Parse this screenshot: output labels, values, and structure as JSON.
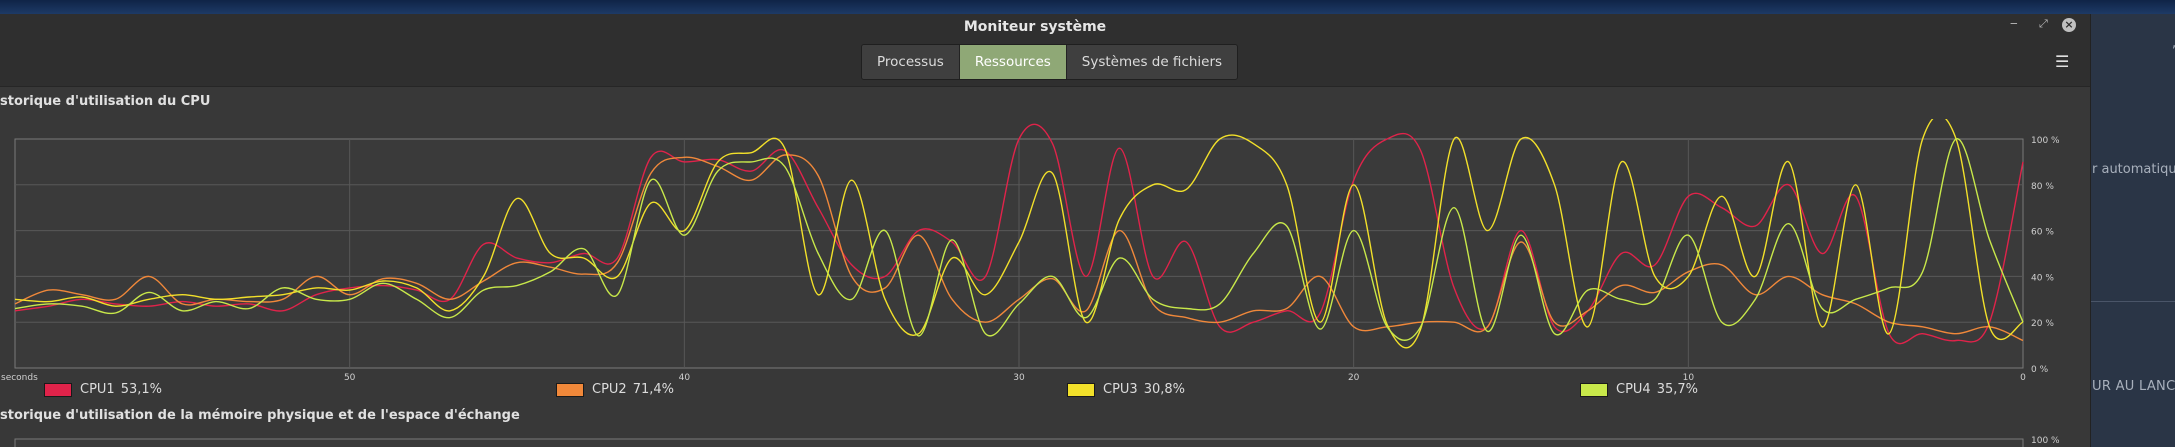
{
  "window": {
    "title": "Moniteur système",
    "tabs": [
      {
        "label": "Processus",
        "active": false
      },
      {
        "label": "Ressources",
        "active": true
      },
      {
        "label": "Systèmes de fichiers",
        "active": false
      }
    ]
  },
  "cpu_section": {
    "title": "storique d'utilisation du CPU",
    "x_ticks": [
      {
        "label": "seconds",
        "value": 60
      },
      {
        "label": "50",
        "value": 50
      },
      {
        "label": "40",
        "value": 40
      },
      {
        "label": "30",
        "value": 30
      },
      {
        "label": "20",
        "value": 20
      },
      {
        "label": "10",
        "value": 10
      },
      {
        "label": "0",
        "value": 0
      }
    ],
    "y_ticks": [
      "0 %",
      "20 %",
      "40 %",
      "60 %",
      "80 %",
      "100 %"
    ]
  },
  "legend": [
    {
      "name": "CPU1",
      "value": "53,1%",
      "color": "#e0234a"
    },
    {
      "name": "CPU2",
      "value": "71,4%",
      "color": "#f0883a"
    },
    {
      "name": "CPU3",
      "value": "30,8%",
      "color": "#f2e02a"
    },
    {
      "name": "CPU4",
      "value": "35,7%",
      "color": "#c8e84a"
    }
  ],
  "mem_section": {
    "title": "storique d'utilisation de la mémoire physique et de l'espace d'échange",
    "y_top_label": "100 %"
  },
  "side_panel": {
    "text1": "r automatiques",
    "text2": "UR AU LANCE"
  },
  "chart_data": {
    "type": "line",
    "title": "storique d'utilisation du CPU",
    "xlabel": "seconds",
    "ylabel": "",
    "xlim": [
      60,
      0
    ],
    "ylim": [
      0,
      100
    ],
    "grid": true,
    "legend_position": "bottom",
    "x": [
      60,
      59,
      58,
      57,
      56,
      55,
      54,
      53,
      52,
      51,
      50,
      49,
      48,
      47,
      46,
      45,
      44,
      43,
      42,
      41,
      40,
      39,
      38,
      37,
      36,
      35,
      34,
      33,
      32,
      31,
      30,
      29,
      28,
      27,
      26,
      25,
      24,
      23,
      22,
      21,
      20,
      19,
      18,
      17,
      16,
      15,
      14,
      13,
      12,
      11,
      10,
      9,
      8,
      7,
      6,
      5,
      4,
      3,
      2,
      1,
      0
    ],
    "series": [
      {
        "name": "CPU1",
        "color": "#e0234a",
        "values": [
          25,
          27,
          30,
          28,
          27,
          29,
          27,
          28,
          25,
          32,
          35,
          36,
          34,
          30,
          54,
          48,
          46,
          50,
          48,
          92,
          90,
          91,
          86,
          95,
          70,
          45,
          40,
          60,
          55,
          40,
          100,
          98,
          40,
          96,
          40,
          55,
          18,
          20,
          25,
          24,
          82,
          100,
          95,
          35,
          18,
          60,
          18,
          25,
          50,
          45,
          75,
          70,
          62,
          80,
          50,
          75,
          15,
          15,
          12,
          20,
          90
        ]
      },
      {
        "name": "CPU2",
        "color": "#f0883a",
        "values": [
          28,
          34,
          32,
          30,
          40,
          28,
          30,
          29,
          30,
          40,
          32,
          39,
          37,
          30,
          38,
          46,
          44,
          41,
          46,
          85,
          92,
          88,
          82,
          93,
          84,
          40,
          35,
          58,
          30,
          20,
          30,
          39,
          25,
          60,
          28,
          22,
          20,
          25,
          26,
          40,
          18,
          18,
          20,
          20,
          18,
          55,
          20,
          25,
          36,
          33,
          42,
          45,
          32,
          40,
          32,
          28,
          20,
          18,
          15,
          18,
          12
        ]
      },
      {
        "name": "CPU3",
        "color": "#f2e02a",
        "values": [
          30,
          29,
          31,
          27,
          30,
          32,
          30,
          31,
          32,
          35,
          34,
          38,
          35,
          25,
          40,
          74,
          50,
          48,
          40,
          72,
          60,
          90,
          94,
          96,
          32,
          82,
          30,
          15,
          48,
          32,
          55,
          85,
          20,
          65,
          80,
          78,
          100,
          98,
          80,
          20,
          80,
          19,
          17,
          100,
          60,
          100,
          80,
          18,
          90,
          40,
          40,
          75,
          40,
          90,
          18,
          80,
          15,
          100,
          100,
          18,
          20
        ]
      },
      {
        "name": "CPU4",
        "color": "#c8e84a",
        "values": [
          26,
          28,
          27,
          24,
          33,
          25,
          29,
          26,
          35,
          30,
          30,
          37,
          30,
          22,
          34,
          36,
          42,
          52,
          32,
          82,
          58,
          86,
          90,
          88,
          50,
          30,
          60,
          14,
          56,
          15,
          28,
          40,
          22,
          48,
          30,
          26,
          28,
          50,
          62,
          17,
          60,
          18,
          18,
          70,
          16,
          58,
          15,
          34,
          30,
          30,
          58,
          20,
          30,
          63,
          26,
          30,
          35,
          42,
          100,
          56,
          20
        ]
      }
    ]
  }
}
